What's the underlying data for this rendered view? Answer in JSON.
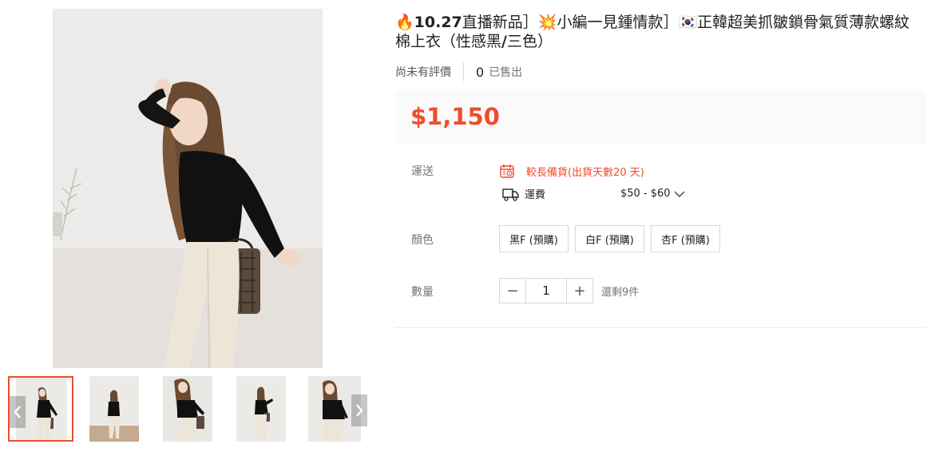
{
  "title": {
    "prefix_emoji": "🔥",
    "bold_part": "10.27",
    "part1": "直播新品］",
    "emoji2": "💥",
    "part2": "小編一見鍾情款］",
    "emoji3": "🇰🇷",
    "part3": "正韓超美抓皺鎖骨氣質薄款螺紋棉上衣（性感黑",
    "bold_slash": "/",
    "part4": "三色）"
  },
  "meta": {
    "rating_text": "尚未有評價",
    "sold_count": "0",
    "sold_label": "已售出"
  },
  "price": "$1,150",
  "shipping": {
    "label": "運送",
    "warning": "較長備貨(出貨天數20 天)",
    "fee_label": "運費",
    "fee_range": "$50 - $60"
  },
  "color": {
    "label": "顏色",
    "options": [
      "黑F (預購)",
      "白F (預購)",
      "杏F (預購)"
    ]
  },
  "quantity": {
    "label": "數量",
    "minus": "−",
    "value": "1",
    "plus": "+",
    "stock": "還剩9件"
  },
  "colors": {
    "accent": "#ee4d2d",
    "price_bg": "#fafafa"
  },
  "icons": {
    "calendar": "calendar-icon",
    "truck": "truck-icon",
    "chevron": "chevron-down-icon",
    "thumb_prev": "chevron-left-icon",
    "thumb_next": "chevron-right-icon"
  }
}
